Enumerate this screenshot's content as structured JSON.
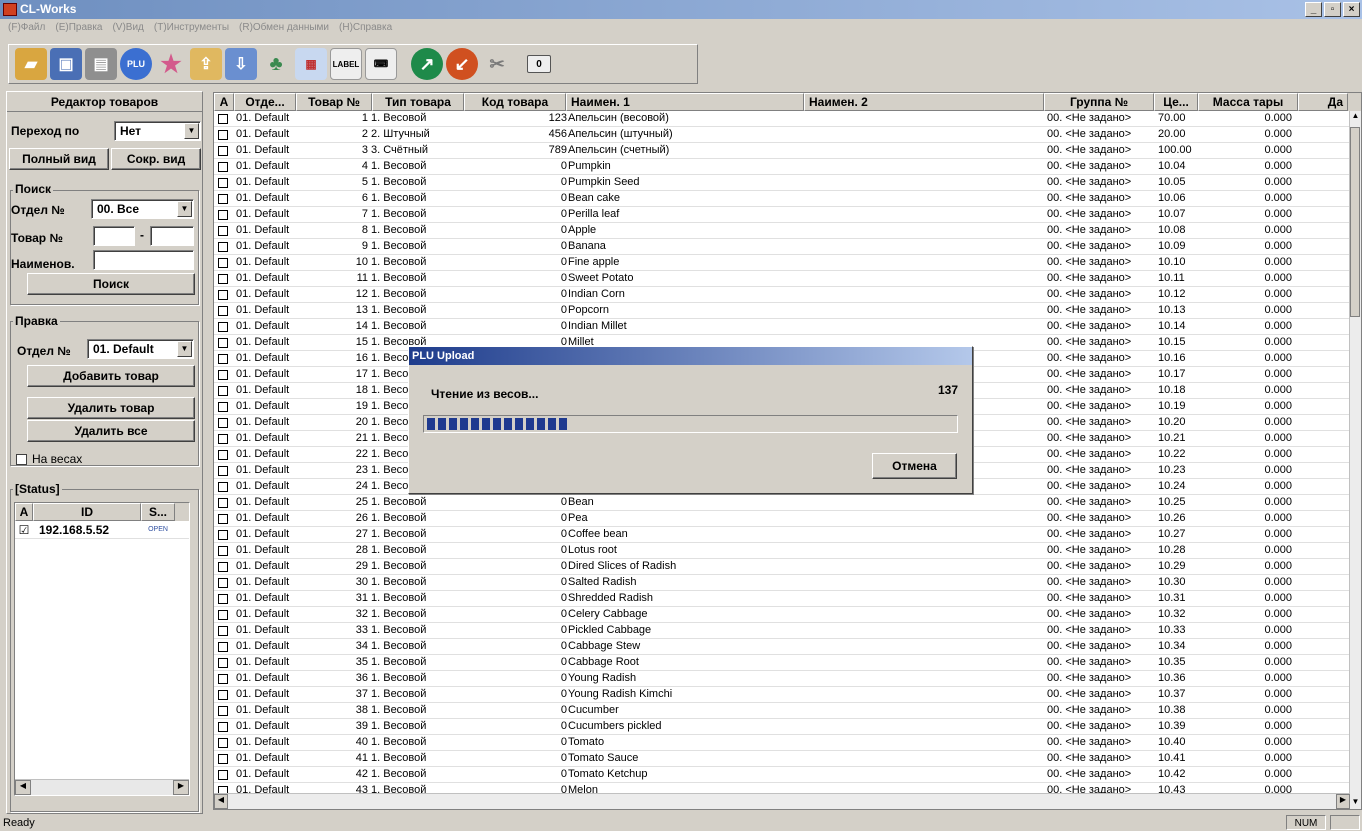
{
  "window": {
    "title": "CL-Works"
  },
  "menu": [
    "(F)Файл",
    "(E)Правка",
    "(V)Вид",
    "(T)Инструменты",
    "(R)Обмен данными",
    "(H)Справка"
  ],
  "toolbar": {
    "scale_label": "LABEL",
    "counter": "0"
  },
  "left": {
    "title": "Редактор товаров",
    "goto_label": "Переход по",
    "goto_value": "Нет",
    "full_view": "Полный вид",
    "short_view": "Сокр. вид",
    "search_group": "Поиск",
    "dept_label": "Отдел №",
    "dept_value": "00. Все",
    "item_label": "Товар №",
    "name_label": "Наименов.",
    "search_button": "Поиск",
    "edit_group": "Правка",
    "edit_dept_label": "Отдел №",
    "edit_dept_value": "01. Default",
    "add_item": "Добавить товар",
    "delete_item": "Удалить товар",
    "delete_all": "Удалить все",
    "on_scales": "На весах",
    "status_group": "[Status]",
    "status_cols": [
      "A",
      "ID",
      "S..."
    ],
    "status_row": {
      "id": "192.168.5.52",
      "s": "OPEN"
    }
  },
  "grid": {
    "columns": [
      "A",
      "Отде...",
      "Товар №",
      "Тип товара",
      "Код товара",
      "Наимен. 1",
      "Наимен. 2",
      "Группа №",
      "Це...",
      "Масса тары",
      "Да"
    ],
    "rows": [
      [
        "01. Default",
        "1",
        "1. Весовой",
        "123",
        "Апельсин (весовой)",
        "00. <Не задано>",
        "70.00",
        "0.000"
      ],
      [
        "01. Default",
        "2",
        "2. Штучный",
        "456",
        "Апельсин (штучный)",
        "00. <Не задано>",
        "20.00",
        "0.000"
      ],
      [
        "01. Default",
        "3",
        "3. Счётный",
        "789",
        "Апельсин (счетный)",
        "00. <Не задано>",
        "100.00",
        "0.000"
      ],
      [
        "01. Default",
        "4",
        "1. Весовой",
        "0",
        "Pumpkin",
        "00. <Не задано>",
        "10.04",
        "0.000"
      ],
      [
        "01. Default",
        "5",
        "1. Весовой",
        "0",
        "Pumpkin Seed",
        "00. <Не задано>",
        "10.05",
        "0.000"
      ],
      [
        "01. Default",
        "6",
        "1. Весовой",
        "0",
        "Bean cake",
        "00. <Не задано>",
        "10.06",
        "0.000"
      ],
      [
        "01. Default",
        "7",
        "1. Весовой",
        "0",
        "Perilla leaf",
        "00. <Не задано>",
        "10.07",
        "0.000"
      ],
      [
        "01. Default",
        "8",
        "1. Весовой",
        "0",
        "Apple",
        "00. <Не задано>",
        "10.08",
        "0.000"
      ],
      [
        "01. Default",
        "9",
        "1. Весовой",
        "0",
        "Banana",
        "00. <Не задано>",
        "10.09",
        "0.000"
      ],
      [
        "01. Default",
        "10",
        "1. Весовой",
        "0",
        "Fine apple",
        "00. <Не задано>",
        "10.10",
        "0.000"
      ],
      [
        "01. Default",
        "11",
        "1. Весовой",
        "0",
        "Sweet Potato",
        "00. <Не задано>",
        "10.11",
        "0.000"
      ],
      [
        "01. Default",
        "12",
        "1. Весовой",
        "0",
        "Indian Corn",
        "00. <Не задано>",
        "10.12",
        "0.000"
      ],
      [
        "01. Default",
        "13",
        "1. Весовой",
        "0",
        "Popcorn",
        "00. <Не задано>",
        "10.13",
        "0.000"
      ],
      [
        "01. Default",
        "14",
        "1. Весовой",
        "0",
        "Indian Millet",
        "00. <Не задано>",
        "10.14",
        "0.000"
      ],
      [
        "01. Default",
        "15",
        "1. Весовой",
        "0",
        "Millet",
        "00. <Не задано>",
        "10.15",
        "0.000"
      ],
      [
        "01. Default",
        "16",
        "1. Весовой",
        "",
        "",
        "00. <Не задано>",
        "10.16",
        "0.000"
      ],
      [
        "01. Default",
        "17",
        "1. Весовой",
        "",
        "",
        "00. <Не задано>",
        "10.17",
        "0.000"
      ],
      [
        "01. Default",
        "18",
        "1. Весовой",
        "",
        "",
        "00. <Не задано>",
        "10.18",
        "0.000"
      ],
      [
        "01. Default",
        "19",
        "1. Весовой",
        "",
        "",
        "00. <Не задано>",
        "10.19",
        "0.000"
      ],
      [
        "01. Default",
        "20",
        "1. Весовой",
        "",
        "",
        "00. <Не задано>",
        "10.20",
        "0.000"
      ],
      [
        "01. Default",
        "21",
        "1. Весовой",
        "",
        "",
        "00. <Не задано>",
        "10.21",
        "0.000"
      ],
      [
        "01. Default",
        "22",
        "1. Весовой",
        "",
        "",
        "00. <Не задано>",
        "10.22",
        "0.000"
      ],
      [
        "01. Default",
        "23",
        "1. Весовой",
        "",
        "",
        "00. <Не задано>",
        "10.23",
        "0.000"
      ],
      [
        "01. Default",
        "24",
        "1. Весовой",
        "",
        "",
        "00. <Не задано>",
        "10.24",
        "0.000"
      ],
      [
        "01. Default",
        "25",
        "1. Весовой",
        "0",
        "Bean",
        "00. <Не задано>",
        "10.25",
        "0.000"
      ],
      [
        "01. Default",
        "26",
        "1. Весовой",
        "0",
        "Pea",
        "00. <Не задано>",
        "10.26",
        "0.000"
      ],
      [
        "01. Default",
        "27",
        "1. Весовой",
        "0",
        "Coffee bean",
        "00. <Не задано>",
        "10.27",
        "0.000"
      ],
      [
        "01. Default",
        "28",
        "1. Весовой",
        "0",
        "Lotus root",
        "00. <Не задано>",
        "10.28",
        "0.000"
      ],
      [
        "01. Default",
        "29",
        "1. Весовой",
        "0",
        "Dired Slices of Radish",
        "00. <Не задано>",
        "10.29",
        "0.000"
      ],
      [
        "01. Default",
        "30",
        "1. Весовой",
        "0",
        "Salted Radish",
        "00. <Не задано>",
        "10.30",
        "0.000"
      ],
      [
        "01. Default",
        "31",
        "1. Весовой",
        "0",
        "Shredded Radish",
        "00. <Не задано>",
        "10.31",
        "0.000"
      ],
      [
        "01. Default",
        "32",
        "1. Весовой",
        "0",
        "Celery Cabbage",
        "00. <Не задано>",
        "10.32",
        "0.000"
      ],
      [
        "01. Default",
        "33",
        "1. Весовой",
        "0",
        "Pickled Cabbage",
        "00. <Не задано>",
        "10.33",
        "0.000"
      ],
      [
        "01. Default",
        "34",
        "1. Весовой",
        "0",
        "Cabbage Stew",
        "00. <Не задано>",
        "10.34",
        "0.000"
      ],
      [
        "01. Default",
        "35",
        "1. Весовой",
        "0",
        "Cabbage Root",
        "00. <Не задано>",
        "10.35",
        "0.000"
      ],
      [
        "01. Default",
        "36",
        "1. Весовой",
        "0",
        "Young Radish",
        "00. <Не задано>",
        "10.36",
        "0.000"
      ],
      [
        "01. Default",
        "37",
        "1. Весовой",
        "0",
        "Young Radish Kimchi",
        "00. <Не задано>",
        "10.37",
        "0.000"
      ],
      [
        "01. Default",
        "38",
        "1. Весовой",
        "0",
        "Cucumber",
        "00. <Не задано>",
        "10.38",
        "0.000"
      ],
      [
        "01. Default",
        "39",
        "1. Весовой",
        "0",
        "Cucumbers pickled",
        "00. <Не задано>",
        "10.39",
        "0.000"
      ],
      [
        "01. Default",
        "40",
        "1. Весовой",
        "0",
        "Tomato",
        "00. <Не задано>",
        "10.40",
        "0.000"
      ],
      [
        "01. Default",
        "41",
        "1. Весовой",
        "0",
        "Tomato Sauce",
        "00. <Не задано>",
        "10.41",
        "0.000"
      ],
      [
        "01. Default",
        "42",
        "1. Весовой",
        "0",
        "Tomato Ketchup",
        "00. <Не задано>",
        "10.42",
        "0.000"
      ],
      [
        "01. Default",
        "43",
        "1. Весовой",
        "0",
        "Melon",
        "00. <Не задано>",
        "10.43",
        "0.000"
      ]
    ]
  },
  "dialog": {
    "title": "PLU Upload",
    "message": "Чтение из весов...",
    "count": "137",
    "progress": 0.27,
    "cancel": "Отмена"
  },
  "statusbar": {
    "text": "Ready",
    "num": "NUM"
  }
}
